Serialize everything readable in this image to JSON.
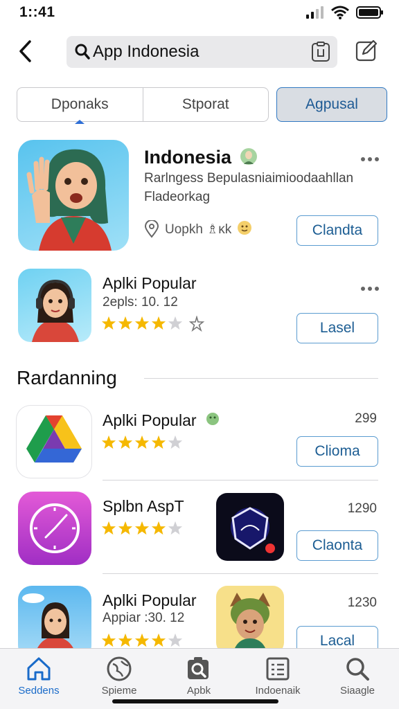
{
  "status": {
    "time": "1::41"
  },
  "search": {
    "query": "App Indonesia"
  },
  "segments": {
    "tabs": [
      "Dponaks",
      "Stporat"
    ],
    "active": "Agpusal"
  },
  "featured": {
    "title": "Indonesia",
    "desc_line1": "Rarlngess Bepulasniaimioodaahllan",
    "desc_line2": "Fladeorkag",
    "meta": "Uopkh ♗ĸk",
    "action": "Clandta"
  },
  "popular": {
    "title": "Aplki Popular",
    "subtitle": "2epls: 10. 12",
    "action": "Lasel",
    "rating": 4
  },
  "section": {
    "title": "Rardanning"
  },
  "list": [
    {
      "title": "Aplki Popular",
      "count": "299",
      "action": "Clioma",
      "rating": 4
    },
    {
      "title": "Splbn AspT",
      "count": "1290",
      "action": "Claonta",
      "rating": 4
    },
    {
      "title": "Aplki Popular",
      "subtitle": "Appiar :30. 12",
      "count": "1230",
      "action": "Lacal",
      "rating": 4
    }
  ],
  "tabbar": [
    {
      "label": "Seddens",
      "icon": "home-icon",
      "active": true
    },
    {
      "label": "Spieme",
      "icon": "globe-icon"
    },
    {
      "label": "Apbk",
      "icon": "apps-search-icon"
    },
    {
      "label": "Indoenaik",
      "icon": "list-icon"
    },
    {
      "label": "Siaagle",
      "icon": "search-icon"
    }
  ],
  "colors": {
    "accent": "#1a6bc9",
    "button_border": "#5a9bd0",
    "star": "#f5b800"
  }
}
